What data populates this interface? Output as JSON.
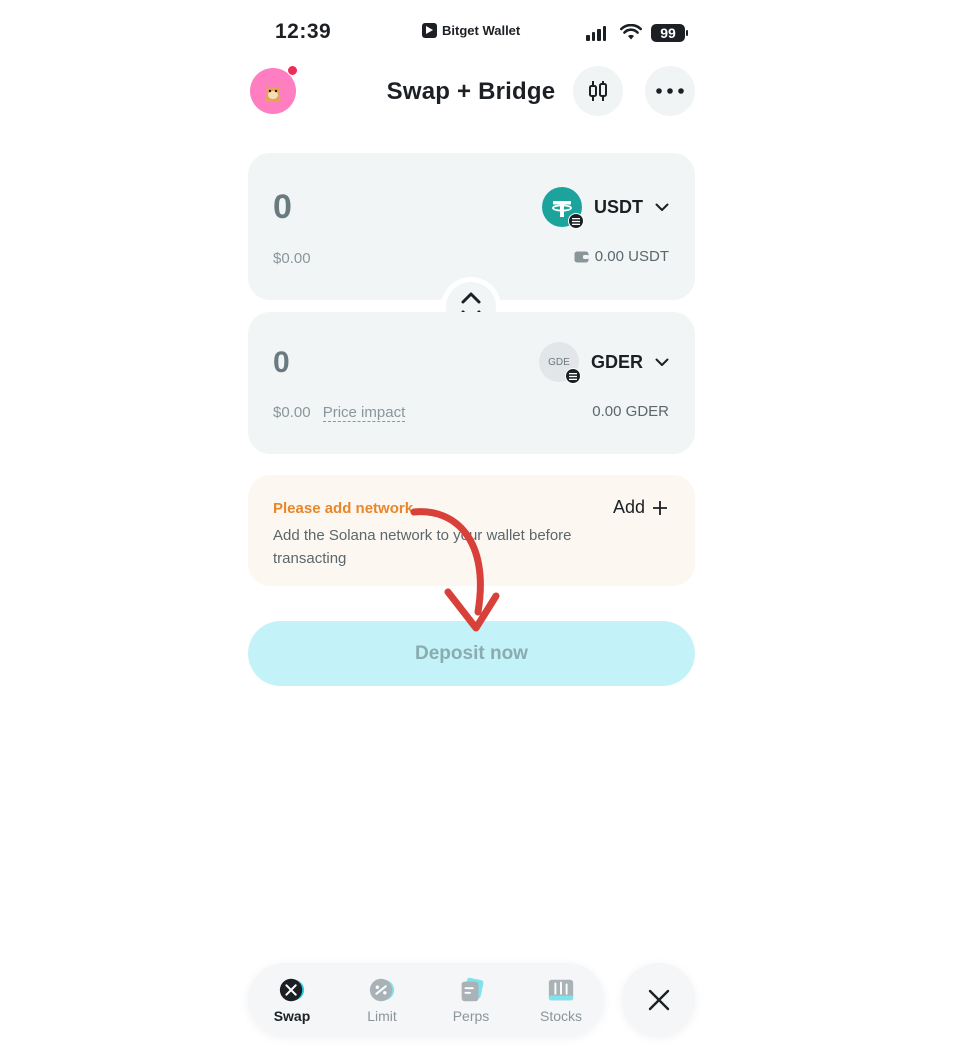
{
  "status_bar": {
    "time": "12:39",
    "app_name": "Bitget Wallet",
    "battery": "99"
  },
  "header": {
    "title": "Swap + Bridge"
  },
  "from_card": {
    "amount": "0",
    "usd_value": "$0.00",
    "token": "USDT",
    "balance": "0.00 USDT"
  },
  "to_card": {
    "amount": "0",
    "usd_value": "$0.00",
    "price_impact_label": "Price impact",
    "token": "GDER",
    "token_icon_text": "GDE",
    "balance": "0.00 GDER"
  },
  "notice": {
    "title": "Please add network",
    "text": "Add the Solana network to your wallet before transacting",
    "add_label": "Add"
  },
  "deposit_button": {
    "label": "Deposit now"
  },
  "bottom_nav": {
    "items": [
      {
        "label": "Swap",
        "icon": "swap-icon",
        "active": true
      },
      {
        "label": "Limit",
        "icon": "limit-icon",
        "active": false
      },
      {
        "label": "Perps",
        "icon": "perps-icon",
        "active": false
      },
      {
        "label": "Stocks",
        "icon": "stocks-icon",
        "active": false
      }
    ]
  },
  "colors": {
    "accent_cyan": "#c3f3f8",
    "warning_orange": "#e8862a",
    "card_bg": "#f1f5f6",
    "annotation_arrow": "#d8403a"
  }
}
